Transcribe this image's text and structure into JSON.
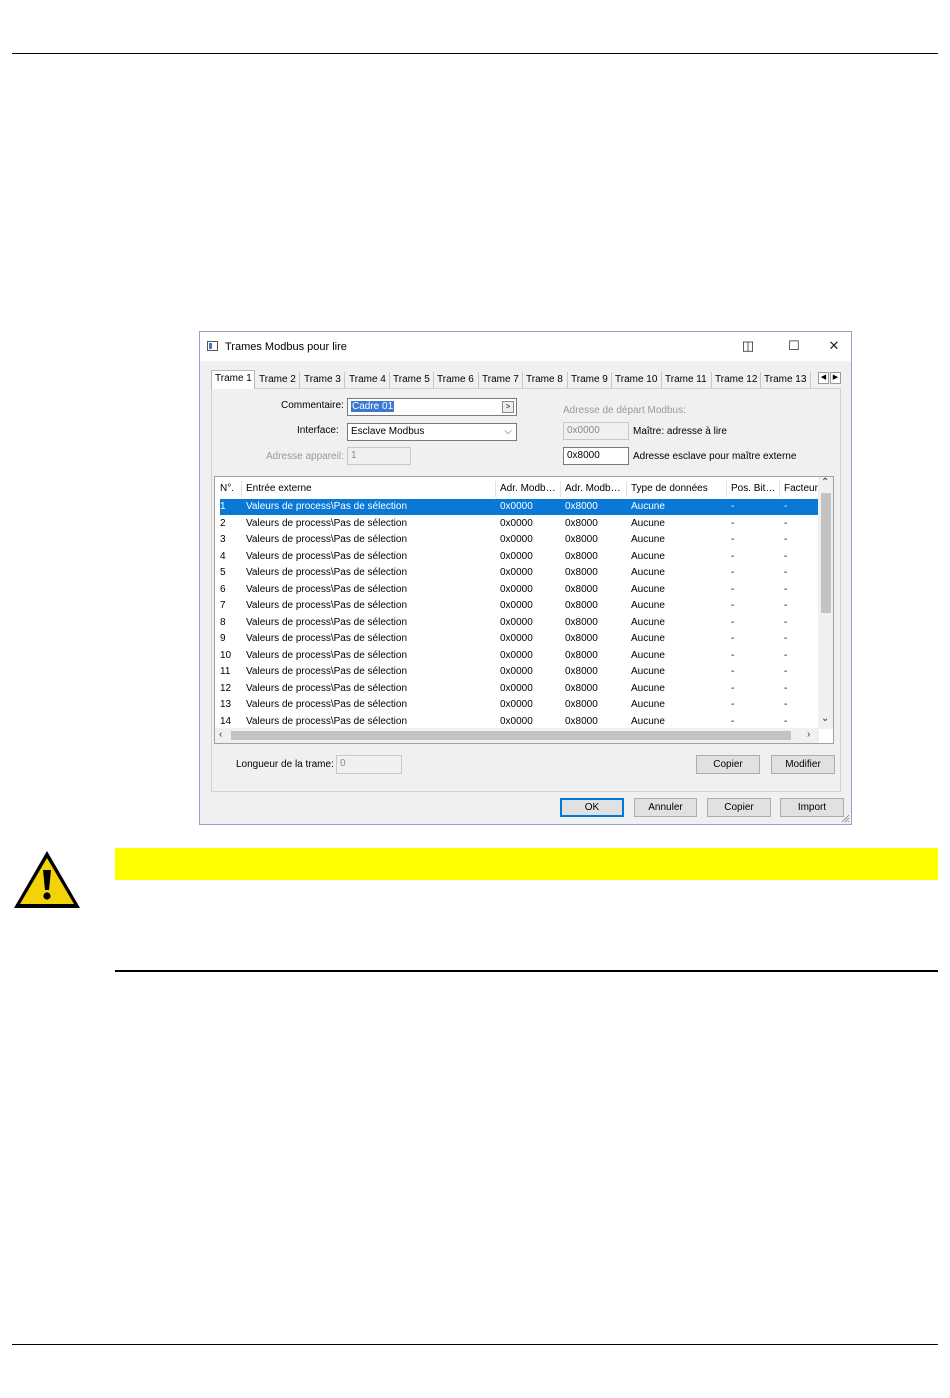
{
  "dialog": {
    "title": "Trames Modbus pour lire",
    "titlebar_buttons": {
      "snap": "◫",
      "maximize": "☐",
      "close": "✕"
    },
    "tabs": [
      "Trame 1",
      "Trame 2",
      "Trame 3",
      "Trame 4",
      "Trame 5",
      "Trame 6",
      "Trame 7",
      "Trame 8",
      "Trame 9",
      "Trame 10",
      "Trame 11",
      "Trame 12",
      "Trame 13"
    ],
    "tab_scroll": {
      "left": "◀",
      "right": "▶"
    },
    "form": {
      "commentaire_label": "Commentaire:",
      "commentaire_value": "Cadre 01",
      "commentaire_button": ">",
      "interface_label": "Interface:",
      "interface_value": "Esclave Modbus",
      "adresse_appareil_label": "Adresse appareil:",
      "adresse_appareil_value": "1",
      "adresse_depart_label": "Adresse de départ Modbus:",
      "maitre_value": "0x0000",
      "maitre_label": "Maître: adresse à lire",
      "esclave_value": "0x8000",
      "esclave_label": "Adresse esclave pour maître externe"
    },
    "table": {
      "columns": [
        "N°.",
        "Entrée externe",
        "Adr. Modb…",
        "Adr. Modb…",
        "Type de données",
        "Pos. Bit…",
        "Facteur"
      ],
      "rows": [
        [
          "1",
          "Valeurs de process\\Pas de sélection",
          "0x0000",
          "0x8000",
          "Aucune",
          "-",
          "-"
        ],
        [
          "2",
          "Valeurs de process\\Pas de sélection",
          "0x0000",
          "0x8000",
          "Aucune",
          "-",
          "-"
        ],
        [
          "3",
          "Valeurs de process\\Pas de sélection",
          "0x0000",
          "0x8000",
          "Aucune",
          "-",
          "-"
        ],
        [
          "4",
          "Valeurs de process\\Pas de sélection",
          "0x0000",
          "0x8000",
          "Aucune",
          "-",
          "-"
        ],
        [
          "5",
          "Valeurs de process\\Pas de sélection",
          "0x0000",
          "0x8000",
          "Aucune",
          "-",
          "-"
        ],
        [
          "6",
          "Valeurs de process\\Pas de sélection",
          "0x0000",
          "0x8000",
          "Aucune",
          "-",
          "-"
        ],
        [
          "7",
          "Valeurs de process\\Pas de sélection",
          "0x0000",
          "0x8000",
          "Aucune",
          "-",
          "-"
        ],
        [
          "8",
          "Valeurs de process\\Pas de sélection",
          "0x0000",
          "0x8000",
          "Aucune",
          "-",
          "-"
        ],
        [
          "9",
          "Valeurs de process\\Pas de sélection",
          "0x0000",
          "0x8000",
          "Aucune",
          "-",
          "-"
        ],
        [
          "10",
          "Valeurs de process\\Pas de sélection",
          "0x0000",
          "0x8000",
          "Aucune",
          "-",
          "-"
        ],
        [
          "11",
          "Valeurs de process\\Pas de sélection",
          "0x0000",
          "0x8000",
          "Aucune",
          "-",
          "-"
        ],
        [
          "12",
          "Valeurs de process\\Pas de sélection",
          "0x0000",
          "0x8000",
          "Aucune",
          "-",
          "-"
        ],
        [
          "13",
          "Valeurs de process\\Pas de sélection",
          "0x0000",
          "0x8000",
          "Aucune",
          "-",
          "-"
        ],
        [
          "14",
          "Valeurs de process\\Pas de sélection",
          "0x0000",
          "0x8000",
          "Aucune",
          "-",
          "-"
        ]
      ],
      "selected_row": 1
    },
    "longueur_label": "Longueur de la trame:",
    "longueur_value": "0",
    "inner_buttons": {
      "copier": "Copier",
      "modifier": "Modifier"
    },
    "footer_buttons": {
      "ok": "OK",
      "annuler": "Annuler",
      "copier": "Copier",
      "import": "Import"
    }
  },
  "colors": {
    "selection": "#0a78d7",
    "warning_bar": "#ffff00"
  }
}
